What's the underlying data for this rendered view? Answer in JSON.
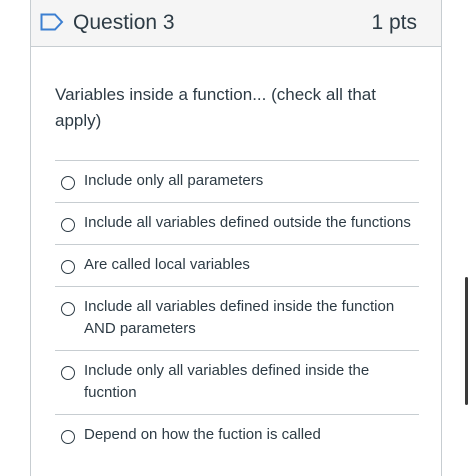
{
  "question": {
    "title": "Question 3",
    "points": "1 pts",
    "text": "Variables inside a function... (check all that apply)"
  },
  "answers": [
    {
      "label": "Include only all parameters",
      "checked": false
    },
    {
      "label": "Include all variables defined outside the functions",
      "checked": false
    },
    {
      "label": "Are called local variables",
      "checked": false
    },
    {
      "label": "Include all variables defined inside the function AND parameters",
      "checked": false
    },
    {
      "label": "Include only all variables defined inside the fucntion",
      "checked": false
    },
    {
      "label": "Depend on how the fuction is called",
      "checked": false
    }
  ],
  "icons": {
    "flag": "bookmark-flag-icon"
  },
  "colors": {
    "flag_stroke": "#3c7fd1",
    "text": "#2d3b45",
    "border": "#c7cdd1",
    "header_bg": "#f5f5f5"
  }
}
